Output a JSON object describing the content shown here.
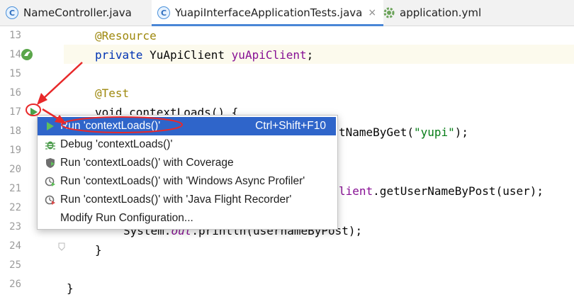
{
  "tabs": [
    {
      "name": "NameController.java",
      "icon": "java-class-icon",
      "icon_letter": "C"
    },
    {
      "name": "YuapiInterfaceApplicationTests.java",
      "icon": "java-class-icon",
      "icon_letter": "C",
      "active": true,
      "close": "×"
    },
    {
      "name": "application.yml",
      "icon": "yaml-config-icon"
    }
  ],
  "line_numbers": [
    "13",
    "14",
    "15",
    "16",
    "17",
    "18",
    "19",
    "20",
    "21",
    "22",
    "23",
    "24",
    "25",
    "26"
  ],
  "code": {
    "l13_annotation": "@Resource",
    "l14_kw": "private",
    "l14_type": " YuApiClient ",
    "l14_field": "yuApiClient",
    "l14_end": ";",
    "l16_annotation": "@Test",
    "l17_text": "void contextLoads() {",
    "l18_pre": "tNameByGet(",
    "l18_str": "\"yupi\"",
    "l18_post": ");",
    "l21_field": "lient",
    "l21_rest": ".getUserNameByPost(user);",
    "l23_pre": "System.",
    "l23_out": "out",
    "l23_post": ".println(usernameByPost);",
    "l24_brace": "}",
    "l26_brace": "}"
  },
  "popup": {
    "items": [
      {
        "label": "Run 'contextLoads()'",
        "shortcut": "Ctrl+Shift+F10",
        "icon": "run-icon",
        "selected": true
      },
      {
        "label": "Debug 'contextLoads()'",
        "icon": "debug-icon"
      },
      {
        "label": "Run 'contextLoads()' with Coverage",
        "icon": "coverage-icon"
      },
      {
        "label": "Run 'contextLoads()' with 'Windows Async Profiler'",
        "icon": "profiler-icon"
      },
      {
        "label": "Run 'contextLoads()' with 'Java Flight Recorder'",
        "icon": "flight-recorder-icon"
      },
      {
        "label": "Modify Run Configuration..."
      }
    ]
  },
  "colors": {
    "accent": "#2f65ca",
    "annotation_red": "#e8292a",
    "keyword": "#0033b3",
    "field": "#871094",
    "string": "#067d17"
  }
}
